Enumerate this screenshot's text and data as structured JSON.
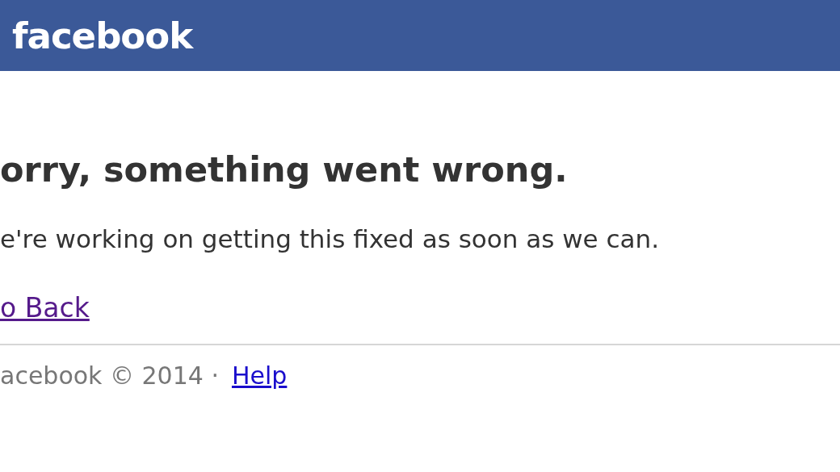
{
  "header": {
    "logo": "facebook"
  },
  "error": {
    "title": "orry, something went wrong.",
    "message": "e're working on getting this fixed as soon as we can.",
    "back_link": {
      "label": "o Back",
      "visited": true
    }
  },
  "footer": {
    "copyright": "acebook © 2014 ·",
    "help_link": {
      "label": "Help",
      "visited": false
    }
  }
}
